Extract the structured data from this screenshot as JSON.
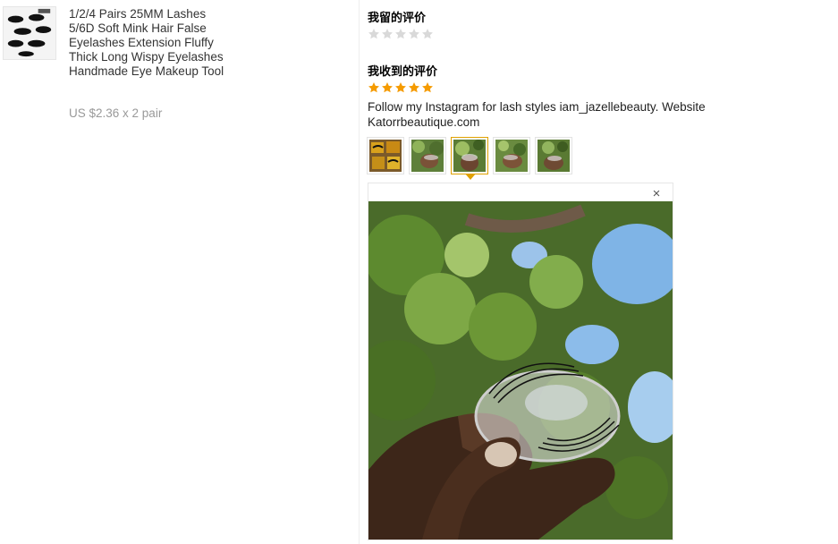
{
  "product": {
    "title": "1/2/4 Pairs 25MM Lashes 5/6D Soft Mink Hair False Eyelashes Extension Fluffy Thick Long Wispy Eyelashes Handmade Eye Makeup Tool",
    "price": "US $2.36 x 2 pair",
    "thumb_icon": "product-image"
  },
  "my_review": {
    "heading": "我留的评价",
    "rating": 0,
    "max_rating": 5
  },
  "received_review": {
    "heading": "我收到的评价",
    "rating": 5,
    "max_rating": 5,
    "text": "Follow my Instagram for lash styles iam_jazellebeauty. Website Katorrbeautique.com",
    "images_count": 5,
    "active_image": 3
  },
  "colors": {
    "star_filled": "#f59b00",
    "star_empty": "#d9d9d9",
    "active_border": "#e0a100"
  },
  "preview": {
    "close_icon": "×"
  }
}
